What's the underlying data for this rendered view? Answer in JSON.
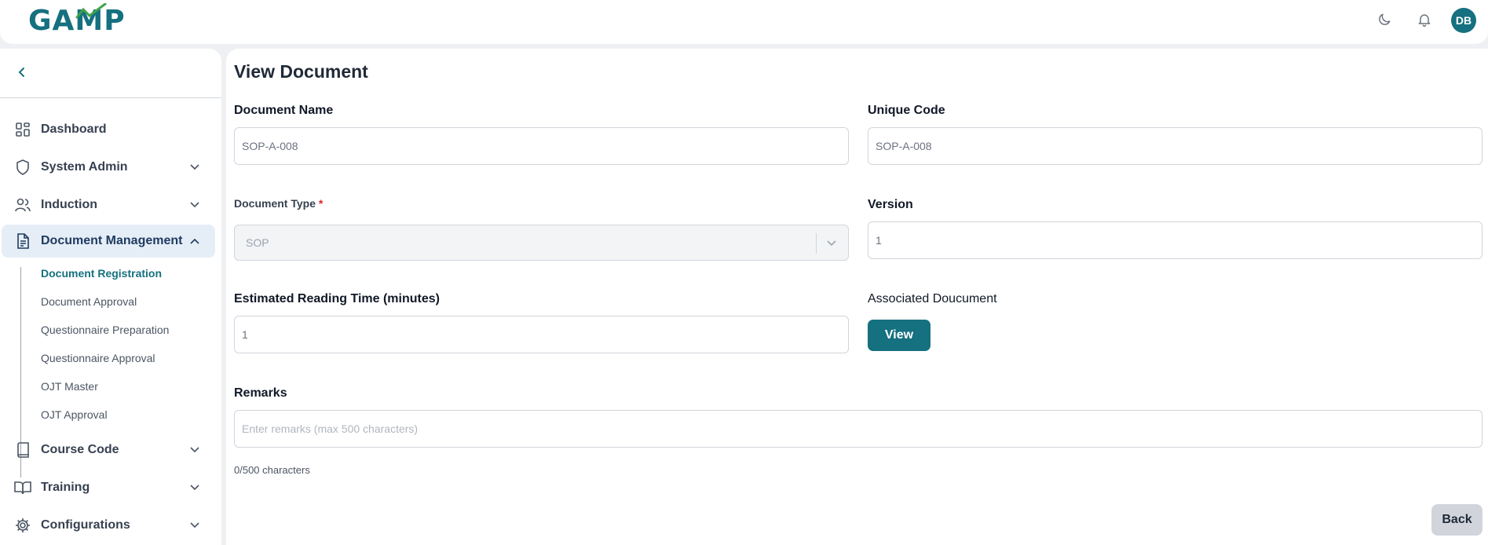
{
  "brand": {
    "logo_text": "GAMP",
    "accent": "#15707f"
  },
  "header": {
    "theme_icon": "moon-icon",
    "notification_icon": "bell-icon",
    "avatar_initials": "DB"
  },
  "sidebar": {
    "collapse_icon": "chevron-left-icon",
    "items": [
      {
        "label": "Dashboard",
        "icon": "grid-icon"
      },
      {
        "label": "System Admin",
        "icon": "shield-icon"
      },
      {
        "label": "Induction",
        "icon": "users-icon"
      },
      {
        "label": "Document Management",
        "icon": "document-icon",
        "expanded": true
      },
      {
        "label": "Course Code",
        "icon": "book-icon"
      },
      {
        "label": "Training",
        "icon": "open-book-icon"
      },
      {
        "label": "Configurations",
        "icon": "gear-icon"
      }
    ],
    "sub_items": [
      {
        "label": "Document Registration",
        "active": true
      },
      {
        "label": "Document Approval"
      },
      {
        "label": "Questionnaire Preparation"
      },
      {
        "label": "Questionnaire Approval"
      },
      {
        "label": "OJT Master"
      },
      {
        "label": "OJT Approval"
      }
    ]
  },
  "main": {
    "title": "View Document",
    "document_name": {
      "label": "Document Name",
      "value": "SOP-A-008"
    },
    "unique_code": {
      "label": "Unique Code",
      "value": "SOP-A-008"
    },
    "document_type": {
      "label": "Document Type",
      "required_mark": "*",
      "value": "SOP"
    },
    "version": {
      "label": "Version",
      "value": "1"
    },
    "reading_time": {
      "label": "Estimated Reading Time (minutes)",
      "value": "1"
    },
    "associated": {
      "label": "Associated Doucument",
      "button": "View"
    },
    "remarks": {
      "label": "Remarks",
      "placeholder": "Enter remarks (max 500 characters)",
      "counter": "0/500 characters"
    },
    "back_button": "Back"
  }
}
